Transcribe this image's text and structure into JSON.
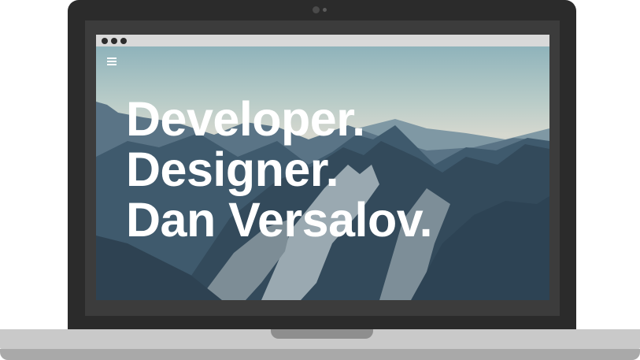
{
  "browser": {
    "window_controls": [
      "close",
      "minimize",
      "maximize"
    ]
  },
  "header": {
    "menu_icon": "hamburger-menu-icon"
  },
  "hero": {
    "lines": [
      "Developer.",
      "Designer.",
      "Dan Versalov."
    ]
  },
  "colors": {
    "laptop_frame": "#2b2b2b",
    "bezel": "#3c3c3c",
    "browser_bar": "#d9d9d9",
    "laptop_base": "#c9c9c9",
    "hero_text": "#ffffff"
  }
}
